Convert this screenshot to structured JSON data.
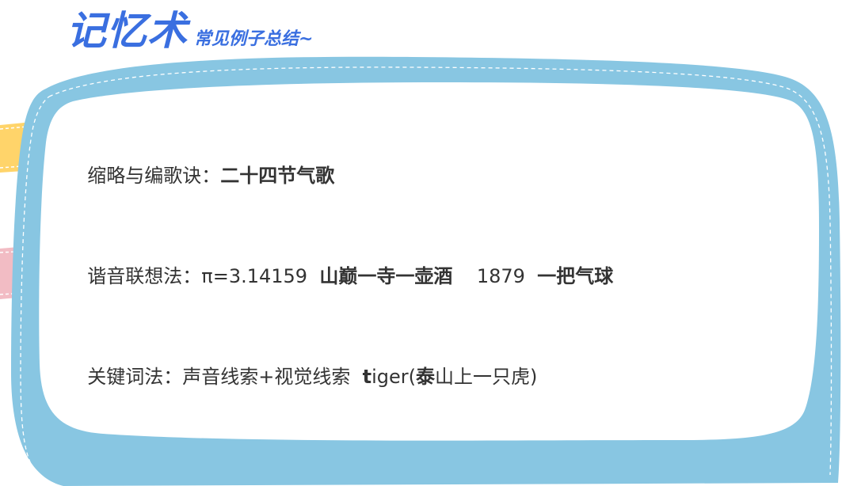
{
  "header": {
    "title": "记忆术",
    "subtitle": "常见例子总结~"
  },
  "lines": [
    {
      "label": "缩略与编歌诀：",
      "value": "二十四节气歌"
    },
    {
      "label": "谐音联想法：",
      "pi_text": "π=3.14159",
      "pi_mnemonic": "山巅一寺一壶酒",
      "number": "1879",
      "number_mnemonic": "一把气球"
    },
    {
      "label": "关键词法：",
      "clue_text": "声音线索+视觉线索",
      "word_t": "t",
      "word_rest": "iger(",
      "tai": "泰",
      "tiger_rest": "山上一只虎)"
    }
  ],
  "colors": {
    "title_blue": "#3a6fe0",
    "board_blue": "#88c6e2",
    "tape_yellow": "#ffd46a",
    "tape_pink": "#f2bcc4",
    "text": "#333333"
  }
}
